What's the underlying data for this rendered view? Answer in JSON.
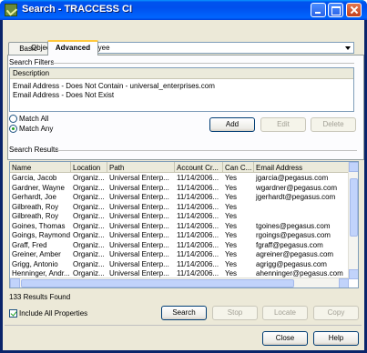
{
  "window": {
    "title": "Search - TRACCESS CI"
  },
  "tabs": [
    {
      "label": "Basic"
    },
    {
      "label": "Advanced"
    }
  ],
  "object_type": {
    "label": "Object Type",
    "value": "Employee"
  },
  "search_filters": {
    "label": "Search Filters",
    "column_header": "Description",
    "rows": [
      "Email Address - Does Not Contain - universal_enterprises.com",
      "Email Address - Does Not Exist"
    ]
  },
  "match": {
    "all_label": "Match All",
    "any_label": "Match Any",
    "selected": "Match Any"
  },
  "filter_buttons": {
    "add": "Add",
    "edit": "Edit",
    "delete": "Delete"
  },
  "search_results": {
    "label": "Search Results",
    "columns": [
      "Name",
      "Location",
      "Path",
      "Account Cr...",
      "Can C...",
      "Email Address"
    ],
    "rows": [
      [
        "Garcia, Jacob",
        "Organiz...",
        "Universal Enterp...",
        "11/14/2006...",
        "Yes",
        "jgarcia@pegasus.com"
      ],
      [
        "Gardner, Wayne",
        "Organiz...",
        "Universal Enterp...",
        "11/14/2006...",
        "Yes",
        "wgardner@pegasus.com"
      ],
      [
        "Gerhardt, Joe",
        "Organiz...",
        "Universal Enterp...",
        "11/14/2006...",
        "Yes",
        "jgerhardt@pegasus.com"
      ],
      [
        "Gilbreath, Roy",
        "Organiz...",
        "Universal Enterp...",
        "11/14/2006...",
        "Yes",
        ""
      ],
      [
        "Gilbreath, Roy",
        "Organiz...",
        "Universal Enterp...",
        "11/14/2006...",
        "Yes",
        ""
      ],
      [
        "Goines, Thomas",
        "Organiz...",
        "Universal Enterp...",
        "11/14/2006...",
        "Yes",
        "tgoines@pegasus.com"
      ],
      [
        "Goings, Raymond",
        "Organiz...",
        "Universal Enterp...",
        "11/14/2006...",
        "Yes",
        "rgoings@pegasus.com"
      ],
      [
        "Graff, Fred",
        "Organiz...",
        "Universal Enterp...",
        "11/14/2006...",
        "Yes",
        "fgraff@pegasus.com"
      ],
      [
        "Greiner, Amber",
        "Organiz...",
        "Universal Enterp...",
        "11/14/2006...",
        "Yes",
        "agreiner@pegasus.com"
      ],
      [
        "Grigg, Antonio",
        "Organiz...",
        "Universal Enterp...",
        "11/14/2006...",
        "Yes",
        "agrigg@pegasus.com"
      ],
      [
        "Henninger, Andr...",
        "Organiz...",
        "Universal Enterp...",
        "11/14/2006...",
        "Yes",
        "ahenninger@pegasus.com"
      ]
    ],
    "count_text": "133 Results Found"
  },
  "include_all": {
    "label": "Include All Properties",
    "checked": true
  },
  "action_buttons": {
    "search": "Search",
    "stop": "Stop",
    "locate": "Locate",
    "copy": "Copy"
  },
  "footer_buttons": {
    "close": "Close",
    "help": "Help"
  }
}
